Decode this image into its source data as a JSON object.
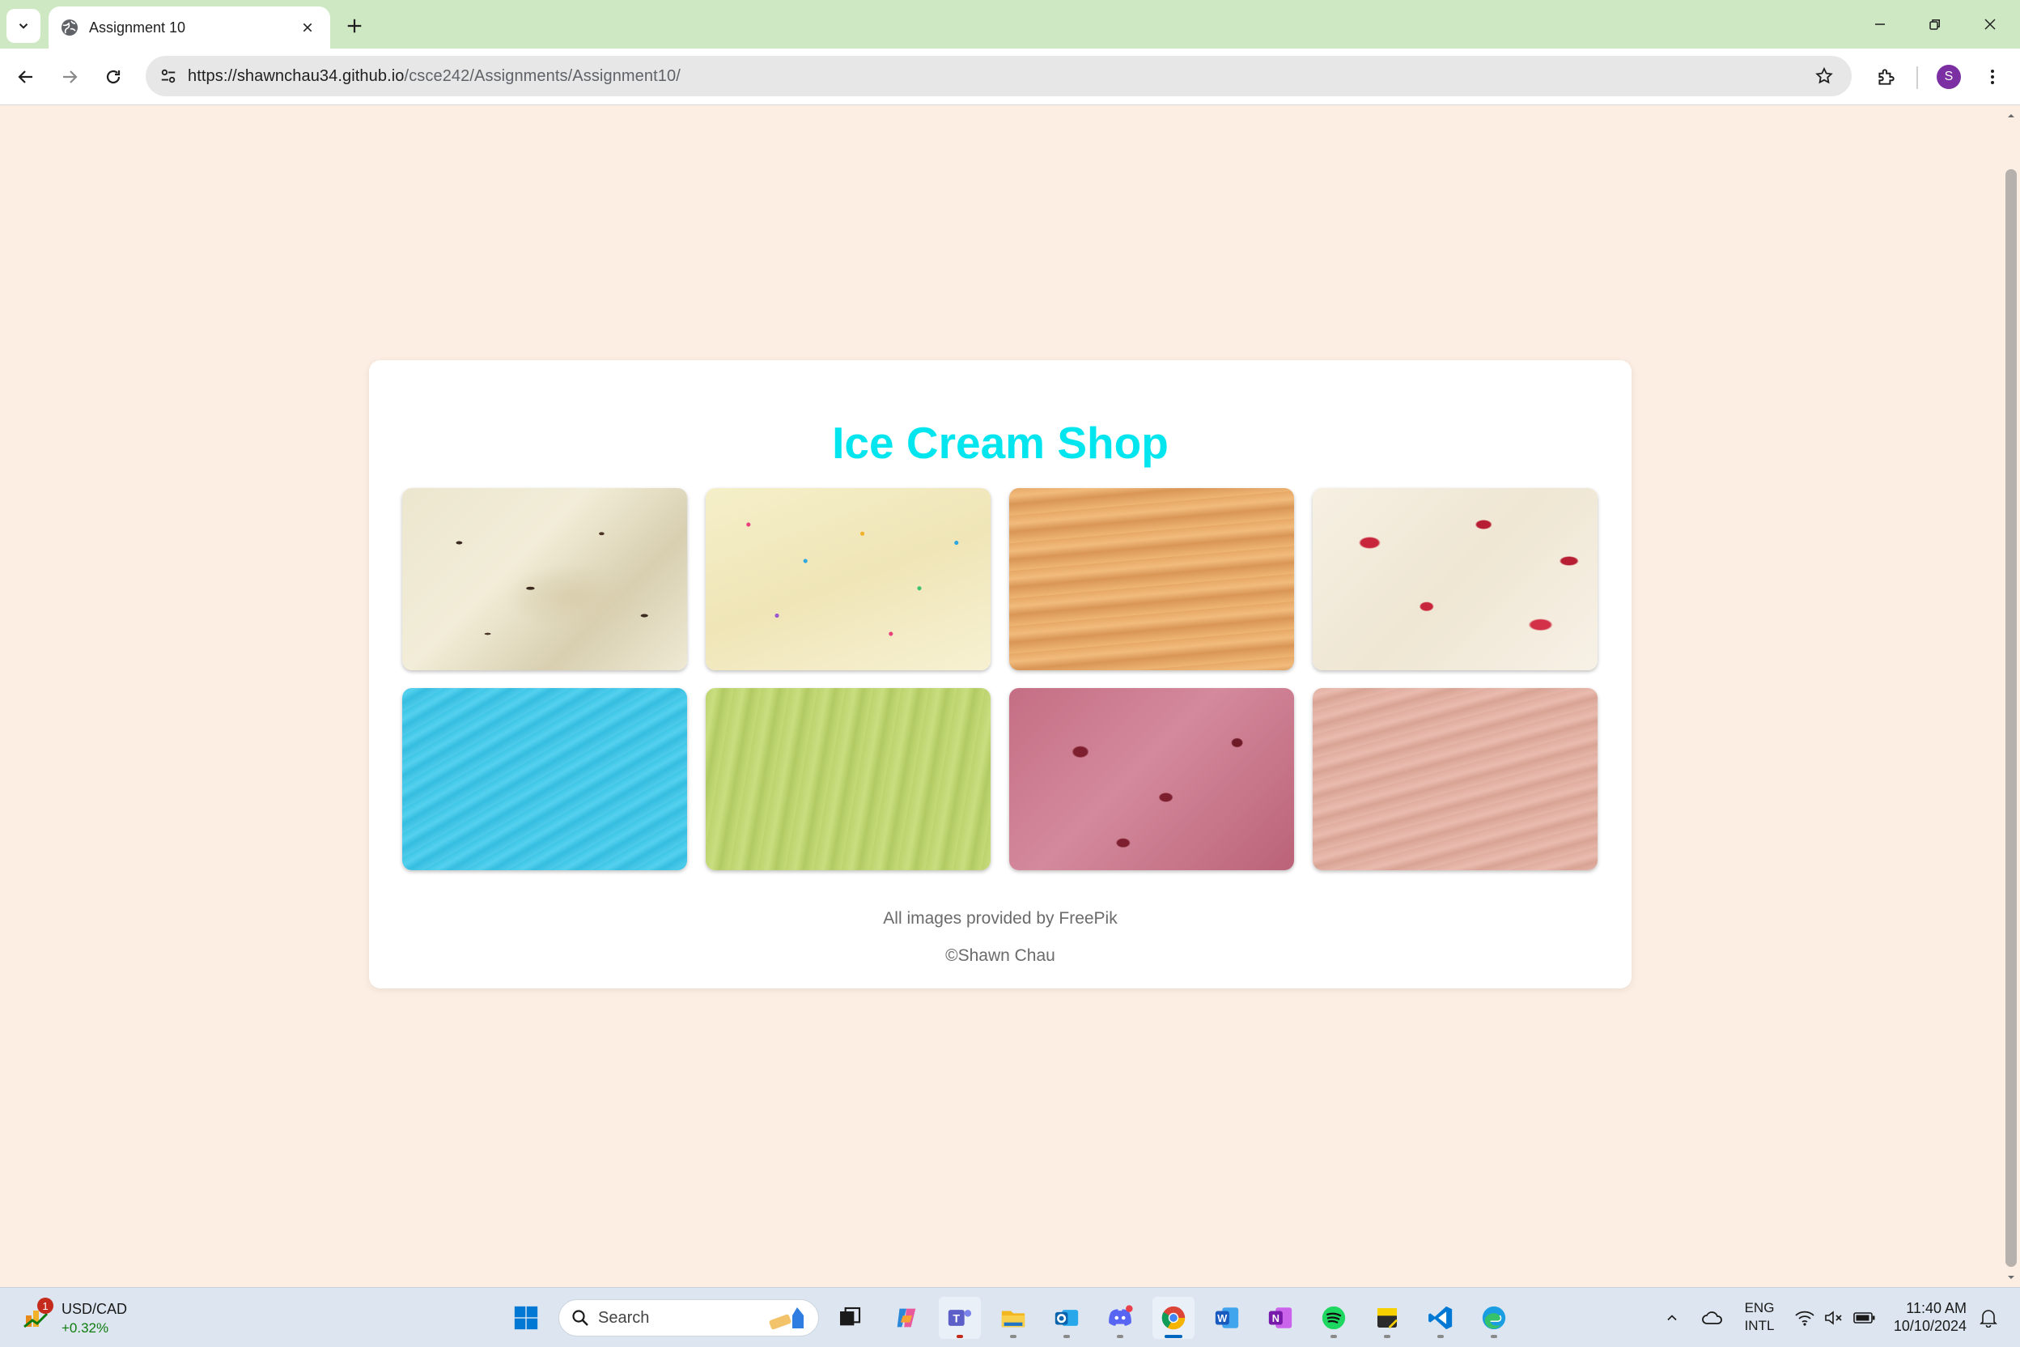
{
  "browser": {
    "tab_title": "Assignment 10",
    "url_host": "https://shawnchau34.github.io",
    "url_path": "/csce242/Assignments/Assignment10/",
    "profile_initial": "S"
  },
  "page": {
    "title": "Ice Cream Shop",
    "title_color": "#00e5ee",
    "flavors": [
      {
        "name": "chocolate-chip-icon"
      },
      {
        "name": "sprinkle-icon"
      },
      {
        "name": "caramel-icon"
      },
      {
        "name": "berry-swirl-icon"
      },
      {
        "name": "blue-icon"
      },
      {
        "name": "pistachio-icon"
      },
      {
        "name": "cherry-icon"
      },
      {
        "name": "strawberry-icon"
      }
    ],
    "credit": "All images provided by FreePik",
    "copyright": "©Shawn Chau"
  },
  "taskbar": {
    "widget_badge": "1",
    "widget_title": "USD/CAD",
    "widget_value": "+0.32%",
    "search_label": "Search",
    "lang_line1": "ENG",
    "lang_line2": "INTL",
    "time": "11:40 AM",
    "date": "10/10/2024"
  }
}
